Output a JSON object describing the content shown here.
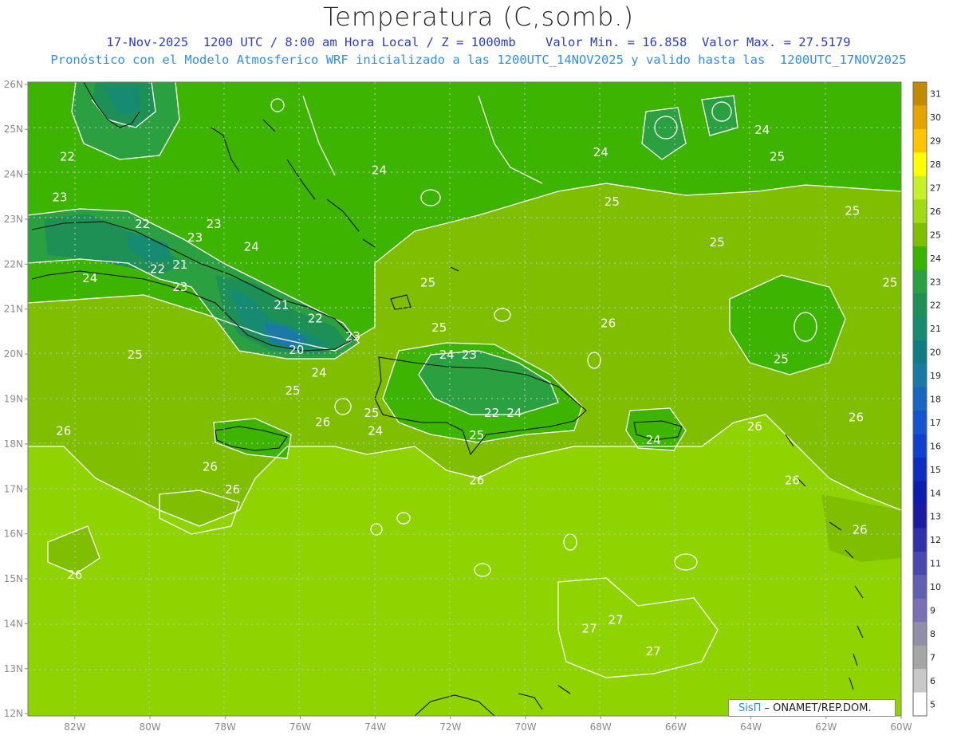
{
  "header": {
    "title": "Temperatura (C,somb.)",
    "subtitle_line1": "17-Nov-2025  1200 UTC / 8:00 am Hora Local / Z = 1000mb    Valor Min. = 16.858  Valor Max. = 27.5179",
    "subtitle_line2": "Pronóstico con el Modelo Atmosferico WRF inicializado a las 1200UTC_14NOV2025 y valido hasta las  1200UTC_17NOV2025"
  },
  "map": {
    "lat_labels": [
      "26N",
      "25N",
      "24N",
      "23N",
      "22N",
      "21N",
      "20N",
      "19N",
      "18N",
      "17N",
      "16N",
      "15N",
      "14N",
      "13N",
      "12N"
    ],
    "lon_labels": [
      "82W",
      "80W",
      "78W",
      "76W",
      "74W",
      "72W",
      "70W",
      "68W",
      "66W",
      "64W",
      "62W",
      "60W"
    ],
    "contour_labels": [
      {
        "text": "22",
        "lon": -82.2,
        "lat": 24.3
      },
      {
        "text": "23",
        "lon": -82.4,
        "lat": 23.4
      },
      {
        "text": "22",
        "lon": -80.2,
        "lat": 22.8
      },
      {
        "text": "23",
        "lon": -78.8,
        "lat": 22.5
      },
      {
        "text": "23",
        "lon": -78.3,
        "lat": 22.8
      },
      {
        "text": "24",
        "lon": -77.3,
        "lat": 22.3
      },
      {
        "text": "22",
        "lon": -79.8,
        "lat": 21.8
      },
      {
        "text": "21",
        "lon": -79.2,
        "lat": 21.9
      },
      {
        "text": "24",
        "lon": -81.6,
        "lat": 21.6
      },
      {
        "text": "23",
        "lon": -79.2,
        "lat": 21.4
      },
      {
        "text": "21",
        "lon": -76.5,
        "lat": 21.0
      },
      {
        "text": "22",
        "lon": -75.6,
        "lat": 20.7
      },
      {
        "text": "23",
        "lon": -74.6,
        "lat": 20.3
      },
      {
        "text": "20",
        "lon": -76.1,
        "lat": 20.0
      },
      {
        "text": "24",
        "lon": -75.5,
        "lat": 19.5
      },
      {
        "text": "25",
        "lon": -80.4,
        "lat": 19.9
      },
      {
        "text": "25",
        "lon": -76.2,
        "lat": 19.1
      },
      {
        "text": "24",
        "lon": -73.9,
        "lat": 24.0
      },
      {
        "text": "24",
        "lon": -68.0,
        "lat": 24.4
      },
      {
        "text": "25",
        "lon": -67.7,
        "lat": 23.3
      },
      {
        "text": "24",
        "lon": -63.7,
        "lat": 24.9
      },
      {
        "text": "25",
        "lon": -63.3,
        "lat": 24.3
      },
      {
        "text": "25",
        "lon": -61.3,
        "lat": 23.1
      },
      {
        "text": "25",
        "lon": -64.9,
        "lat": 22.4
      },
      {
        "text": "25",
        "lon": -60.3,
        "lat": 21.5
      },
      {
        "text": "25",
        "lon": -72.6,
        "lat": 21.5
      },
      {
        "text": "25",
        "lon": -72.3,
        "lat": 20.5
      },
      {
        "text": "26",
        "lon": -67.8,
        "lat": 20.6
      },
      {
        "text": "25",
        "lon": -63.2,
        "lat": 19.8
      },
      {
        "text": "24",
        "lon": -72.1,
        "lat": 19.9
      },
      {
        "text": "23",
        "lon": -71.5,
        "lat": 19.9
      },
      {
        "text": "25",
        "lon": -74.1,
        "lat": 18.6
      },
      {
        "text": "26",
        "lon": -75.4,
        "lat": 18.4
      },
      {
        "text": "24",
        "lon": -74.0,
        "lat": 18.2
      },
      {
        "text": "22",
        "lon": -70.9,
        "lat": 18.6
      },
      {
        "text": "24",
        "lon": -70.3,
        "lat": 18.6
      },
      {
        "text": "25",
        "lon": -71.3,
        "lat": 18.1
      },
      {
        "text": "24",
        "lon": -66.6,
        "lat": 18.0
      },
      {
        "text": "26",
        "lon": -63.9,
        "lat": 18.3
      },
      {
        "text": "26",
        "lon": -61.2,
        "lat": 18.5
      },
      {
        "text": "26",
        "lon": -82.3,
        "lat": 18.2
      },
      {
        "text": "26",
        "lon": -78.4,
        "lat": 17.4
      },
      {
        "text": "26",
        "lon": -77.8,
        "lat": 16.9
      },
      {
        "text": "26",
        "lon": -71.3,
        "lat": 17.1
      },
      {
        "text": "26",
        "lon": -62.9,
        "lat": 17.1
      },
      {
        "text": "26",
        "lon": -61.1,
        "lat": 16.0
      },
      {
        "text": "26",
        "lon": -82.0,
        "lat": 15.0
      },
      {
        "text": "27",
        "lon": -68.3,
        "lat": 13.8
      },
      {
        "text": "27",
        "lon": -67.6,
        "lat": 14.0
      },
      {
        "text": "27",
        "lon": -66.6,
        "lat": 13.3
      }
    ]
  },
  "colorbar": {
    "levels": [
      "31",
      "30",
      "29",
      "28",
      "27",
      "26",
      "25",
      "24",
      "23",
      "22",
      "21",
      "20",
      "19",
      "18",
      "17",
      "16",
      "15",
      "14",
      "13",
      "12",
      "11",
      "10",
      "9",
      "8",
      "7",
      "6",
      "5"
    ],
    "colors": [
      "#c28a00",
      "#e5a400",
      "#ffc400",
      "#ffff00",
      "#c8f028",
      "#a0dc14",
      "#7fbe00",
      "#39b400",
      "#2aa040",
      "#1f9055",
      "#178a72",
      "#0e7c80",
      "#1a7aa5",
      "#1766c0",
      "#1553d0",
      "#1040d0",
      "#0c2dc0",
      "#0c1bb0",
      "#1a1aa5",
      "#3030a8",
      "#4848b0",
      "#6060b0",
      "#7a70b4",
      "#8f8fa8",
      "#a5a5a5",
      "#c8c8c8",
      "#ffffff"
    ]
  },
  "credit": {
    "brand": "SisΠ",
    "text": " – ONAMET/REP.DOM."
  }
}
